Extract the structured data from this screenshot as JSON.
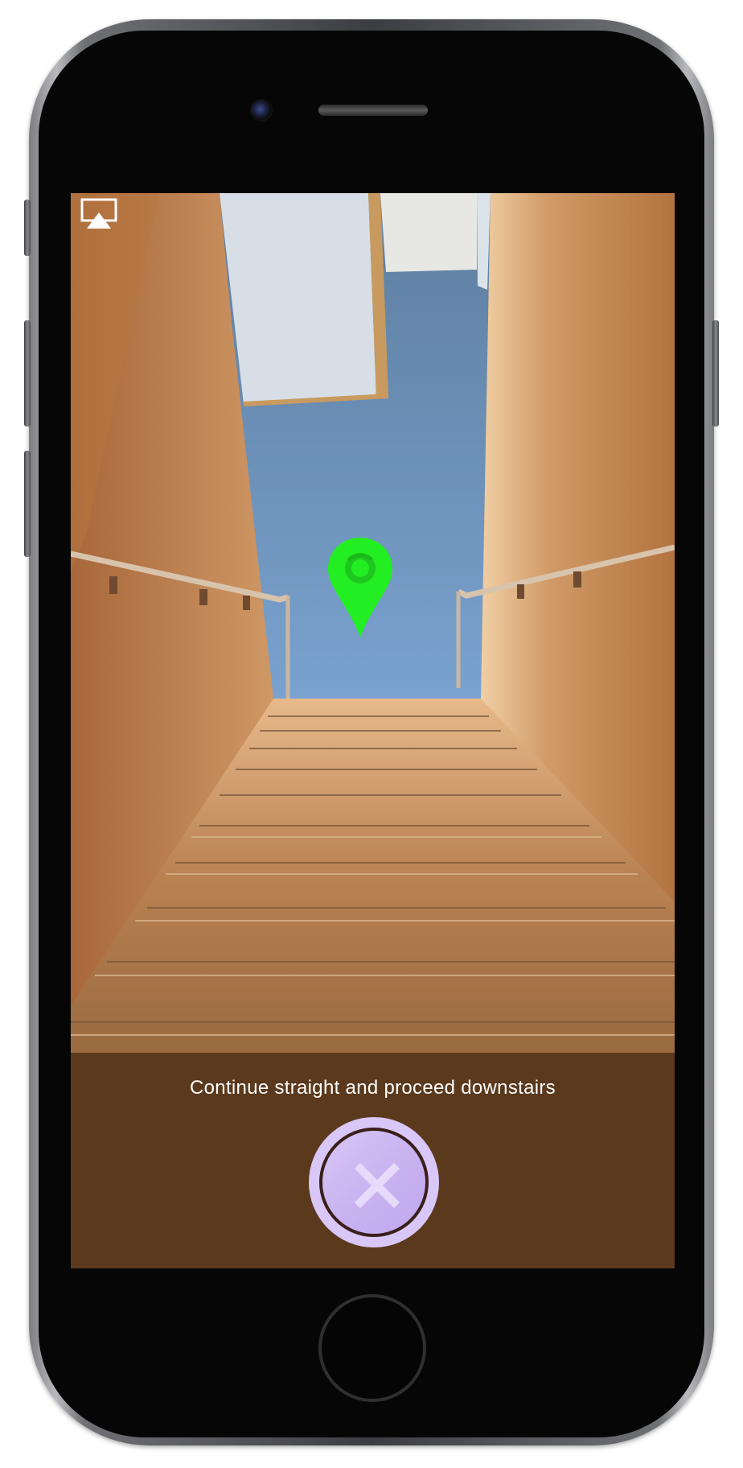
{
  "screen": {
    "instruction": "Continue straight and proceed downstairs",
    "accent_color": "#22ee22",
    "close_button_color": "#d8c7f7"
  },
  "icons": {
    "airplay": "airplay-icon",
    "marker": "location-pin-icon",
    "close": "close-icon"
  }
}
